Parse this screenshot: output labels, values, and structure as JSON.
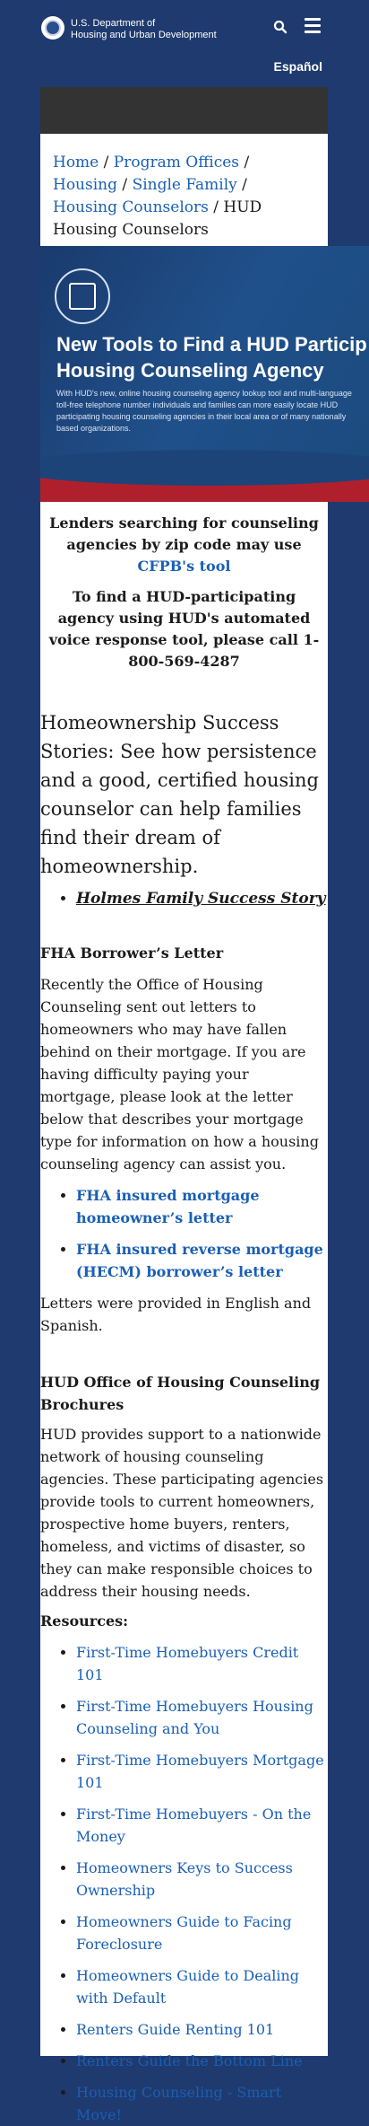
{
  "header": {
    "agency_line1": "U.S. Department of",
    "agency_line2": "Housing and Urban Development",
    "search_icon": "search-icon",
    "menu_icon": "hamburger-menu-icon",
    "language_link": "Español"
  },
  "breadcrumb": {
    "items": [
      "Home",
      "Program Offices",
      "Housing",
      "Single Family",
      "Housing Counselors"
    ],
    "current": "HUD Housing Counselors",
    "separator": "/"
  },
  "banner": {
    "title_line1": "New Tools to Find a HUD Particip",
    "title_line2": "Housing Counseling Agency",
    "text": "With HUD's new, online housing counseling agency lookup tool and multi-language toll-free telephone number individuals and families can more easily locate HUD participating housing counseling agencies in their local area or of many nationally based organizations."
  },
  "lenders": {
    "text_before": "Lenders searching for counseling agencies by zip code may use ",
    "link": "CFPB's tool"
  },
  "find_agency": "To find a HUD-participating agency using HUD's automated voice response tool, please call 1-800-569-4287",
  "stories": {
    "text": "Homeownership Success Stories:  See how persistence and a good, certified housing counselor can help families find their dream of homeownership.",
    "link": "Holmes Family Success Story"
  },
  "fha_letter": {
    "heading": "FHA Borrower’s Letter",
    "body": "Recently the Office of Housing Counseling sent out letters to homeowners who may have fallen behind on their mortgage. If you are having difficulty paying your mortgage, please look at the letter below that describes your mortgage type for information on how a housing counseling agency can assist you.",
    "links": [
      "FHA insured mortgage homeowner’s letter",
      "FHA insured reverse mortgage (HECM) borrower’s letter"
    ],
    "note": "Letters were provided in English and Spanish."
  },
  "brochures": {
    "heading": "HUD Office of Housing Counseling Brochures",
    "body": "HUD provides support to a nationwide network of housing counseling agencies. These participating agencies provide tools to current homeowners, prospective home buyers, renters, homeless, and victims of disaster, so they can make responsible choices to address their housing needs.",
    "resources_label": "Resources:",
    "resources": [
      "First-Time Homebuyers Credit 101",
      "First-Time Homebuyers Housing Counseling and You",
      "First-Time Homebuyers Mortgage 101",
      "First-Time Homebuyers - On the Money",
      "Homeowners Keys to Success Ownership",
      "Homeowners Guide to Facing Foreclosure",
      "Homeowners Guide to Dealing with Default",
      "Renters Guide Renting 101",
      "Renters Guide the Bottom Line",
      "Housing Counseling - Smart Move!"
    ]
  }
}
